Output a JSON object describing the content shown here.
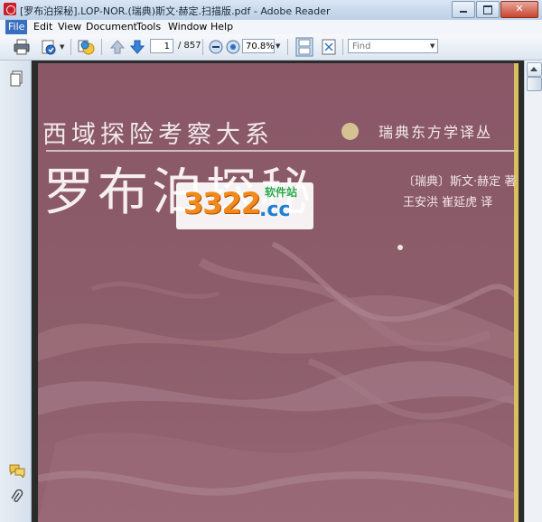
{
  "window": {
    "title": "[罗布泊探秘].LOP-NOR.(瑞典)斯文·赫定.扫描版.pdf - Adobe Reader"
  },
  "menu": {
    "items": [
      "File",
      "Edit",
      "View",
      "Document",
      "Tools",
      "Window",
      "Help"
    ],
    "active": "File"
  },
  "toolbar": {
    "page_current": "1",
    "page_total": "/ 857",
    "zoom": "70.8%",
    "find_placeholder": "Find"
  },
  "navpanel": {
    "icons": [
      "pages-icon",
      "comments-icon",
      "attachments-icon"
    ]
  },
  "document": {
    "series_title": "西域探险考察大系",
    "series_subtitle": "瑞典东方学译丛",
    "book_title": "罗布泊探秘",
    "author_line": "〔瑞典〕斯文·赫定  著",
    "translators_line": "王安洪  崔延虎  译",
    "cover_color": "#8c5a68"
  },
  "watermark": {
    "number": "3322",
    "suffix": ".cc",
    "tag": "软件站"
  }
}
